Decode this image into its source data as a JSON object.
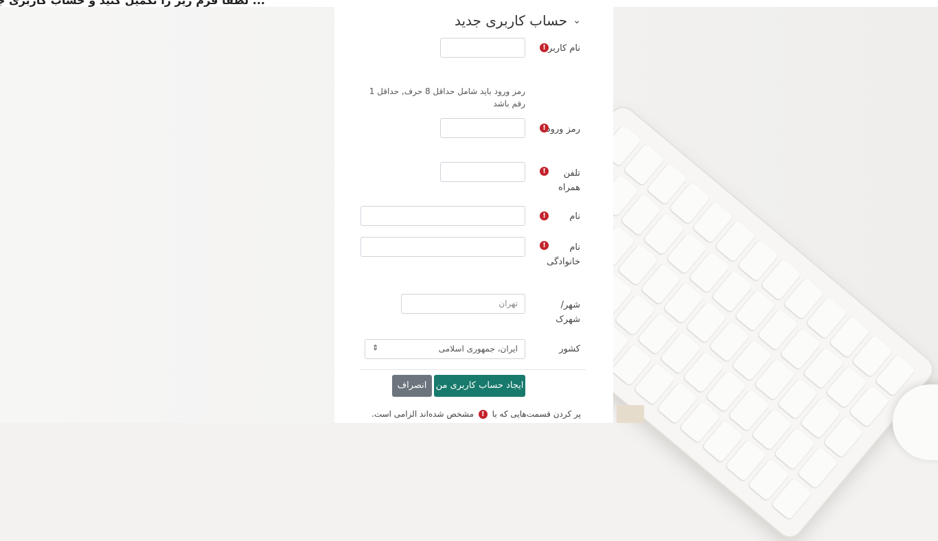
{
  "header": {
    "cut_text": "... لطفاً فرم زیر را تکمیل کنید و حساب کاربری جدید خود را ایجاد کنید ..."
  },
  "section": {
    "title": "حساب کاربری جدید"
  },
  "fields": {
    "username": {
      "label": "نام کاربری",
      "value": ""
    },
    "password_hint": "رمز ورود باید شامل حداقل 8 حرف, حداقل 1 رقم باشد",
    "password": {
      "label": "رمز ورود",
      "value": ""
    },
    "phone": {
      "label": "تلفن همراه",
      "value": ""
    },
    "firstname": {
      "label": "نام",
      "value": ""
    },
    "lastname": {
      "label": "نام خانوادگی",
      "value": ""
    },
    "city": {
      "label": "شهر/ شهرک",
      "placeholder": "تهران"
    },
    "country": {
      "label": "کشور",
      "selected": "ایران، جمهوری اسلامی"
    }
  },
  "required_icon": "!",
  "buttons": {
    "create": "ایجاد حساب کاربری من",
    "cancel": "انصراف"
  },
  "footer": {
    "before": "پر کردن قسمت‌هایی که با",
    "after": "مشخص شده‌اند الزامی است."
  },
  "colors": {
    "primary": "#187a6c",
    "secondary": "#6c757d",
    "required": "#c3222b"
  }
}
